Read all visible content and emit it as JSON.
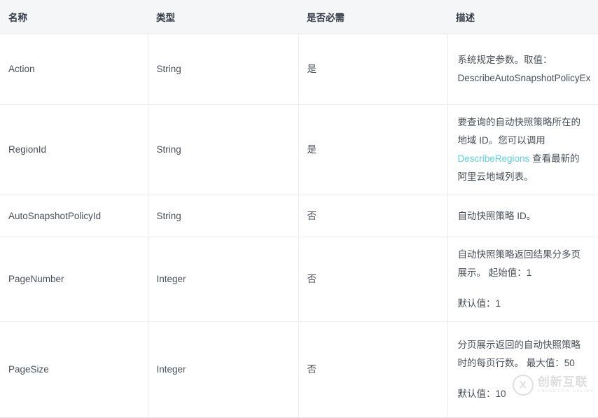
{
  "table": {
    "columns": [
      {
        "key": "name",
        "label": "名称"
      },
      {
        "key": "type",
        "label": "类型"
      },
      {
        "key": "required",
        "label": "是否必需"
      },
      {
        "key": "description",
        "label": "描述"
      }
    ],
    "rows": [
      {
        "name": "Action",
        "type": "String",
        "required": "是",
        "description_lines": [
          "系统规定参数。取值：DescribeAutoSnapshotPolicyEx"
        ]
      },
      {
        "name": "RegionId",
        "type": "String",
        "required": "是",
        "description_prefix": "要查询的自动快照策略所在的地域 ID。您可以调用 ",
        "description_link": "DescribeRegions",
        "description_suffix": " 查看最新的阿里云地域列表。"
      },
      {
        "name": "AutoSnapshotPolicyId",
        "type": "String",
        "required": "否",
        "description_lines": [
          "自动快照策略 ID。"
        ]
      },
      {
        "name": "PageNumber",
        "type": "Integer",
        "required": "否",
        "description_lines": [
          "自动快照策略返回结果分多页展示。 起始值：1",
          "默认值：1"
        ]
      },
      {
        "name": "PageSize",
        "type": "Integer",
        "required": "否",
        "description_lines": [
          "分页展示返回的自动快照策略时的每页行数。 最大值：50",
          "默认值：10"
        ]
      }
    ]
  },
  "watermark": {
    "main_text": "创新互联",
    "sub_text": "CHUANGXIN HULIAN",
    "logo_glyph": "X"
  },
  "colors": {
    "link": "#5fd0dd",
    "header_bg": "#f5f6f7",
    "border": "#e9ebee",
    "text": "#4a4f57"
  }
}
